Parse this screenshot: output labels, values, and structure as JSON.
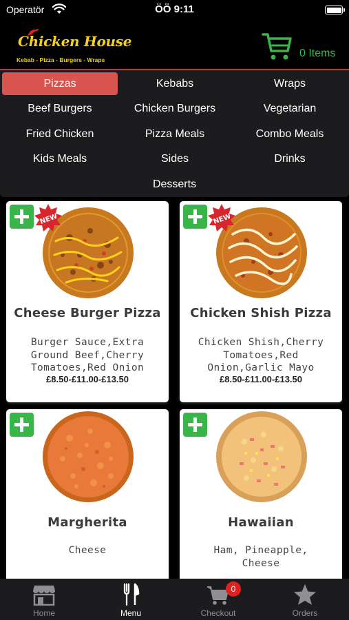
{
  "status_bar": {
    "carrier": "Operatör",
    "time": "ÖÖ 9:11"
  },
  "header": {
    "logo_text": "Chicken House",
    "logo_subtitle": "Kebab - Pizza - Burgers - Wraps",
    "cart_label": "0 Items",
    "colors": {
      "logo": "#f4d21c",
      "cart": "#39b54a",
      "rule": "#d8262e"
    }
  },
  "categories": [
    {
      "label": "Pizzas",
      "active": true
    },
    {
      "label": "Kebabs"
    },
    {
      "label": "Wraps"
    },
    {
      "label": "Beef Burgers"
    },
    {
      "label": "Chicken Burgers"
    },
    {
      "label": "Vegetarian"
    },
    {
      "label": "Fried Chicken"
    },
    {
      "label": "Pizza Meals"
    },
    {
      "label": "Combo Meals"
    },
    {
      "label": "Kids Meals"
    },
    {
      "label": "Sides"
    },
    {
      "label": "Drinks"
    },
    {
      "label": "Desserts"
    }
  ],
  "active_color": "#d9534f",
  "products": [
    {
      "name": "Cheese Burger Pizza",
      "description": "Burger Sauce,Extra Ground Beef,Cherry Tomatoes,Red Onion",
      "price": "£8.50-£11.00-£13.50",
      "badge": "NEW",
      "icon": "add-icon"
    },
    {
      "name": "Chicken Shish Pizza",
      "description": "Chicken Shish,Cherry Tomatoes,Red Onion,Garlic Mayo",
      "price": "£8.50-£11.00-£13.50",
      "badge": "NEW",
      "icon": "add-icon"
    },
    {
      "name": "Margherita",
      "description": "Cheese",
      "price": "",
      "icon": "add-icon"
    },
    {
      "name": "Hawaiian",
      "description": "Ham, Pineapple, Cheese",
      "price": "",
      "icon": "add-icon"
    }
  ],
  "tabs": [
    {
      "label": "Home",
      "icon": "store-icon"
    },
    {
      "label": "Menu",
      "icon": "fork-knife-icon",
      "active": true
    },
    {
      "label": "Checkout",
      "icon": "cart-icon",
      "badge": "0"
    },
    {
      "label": "Orders",
      "icon": "star-icon"
    }
  ]
}
